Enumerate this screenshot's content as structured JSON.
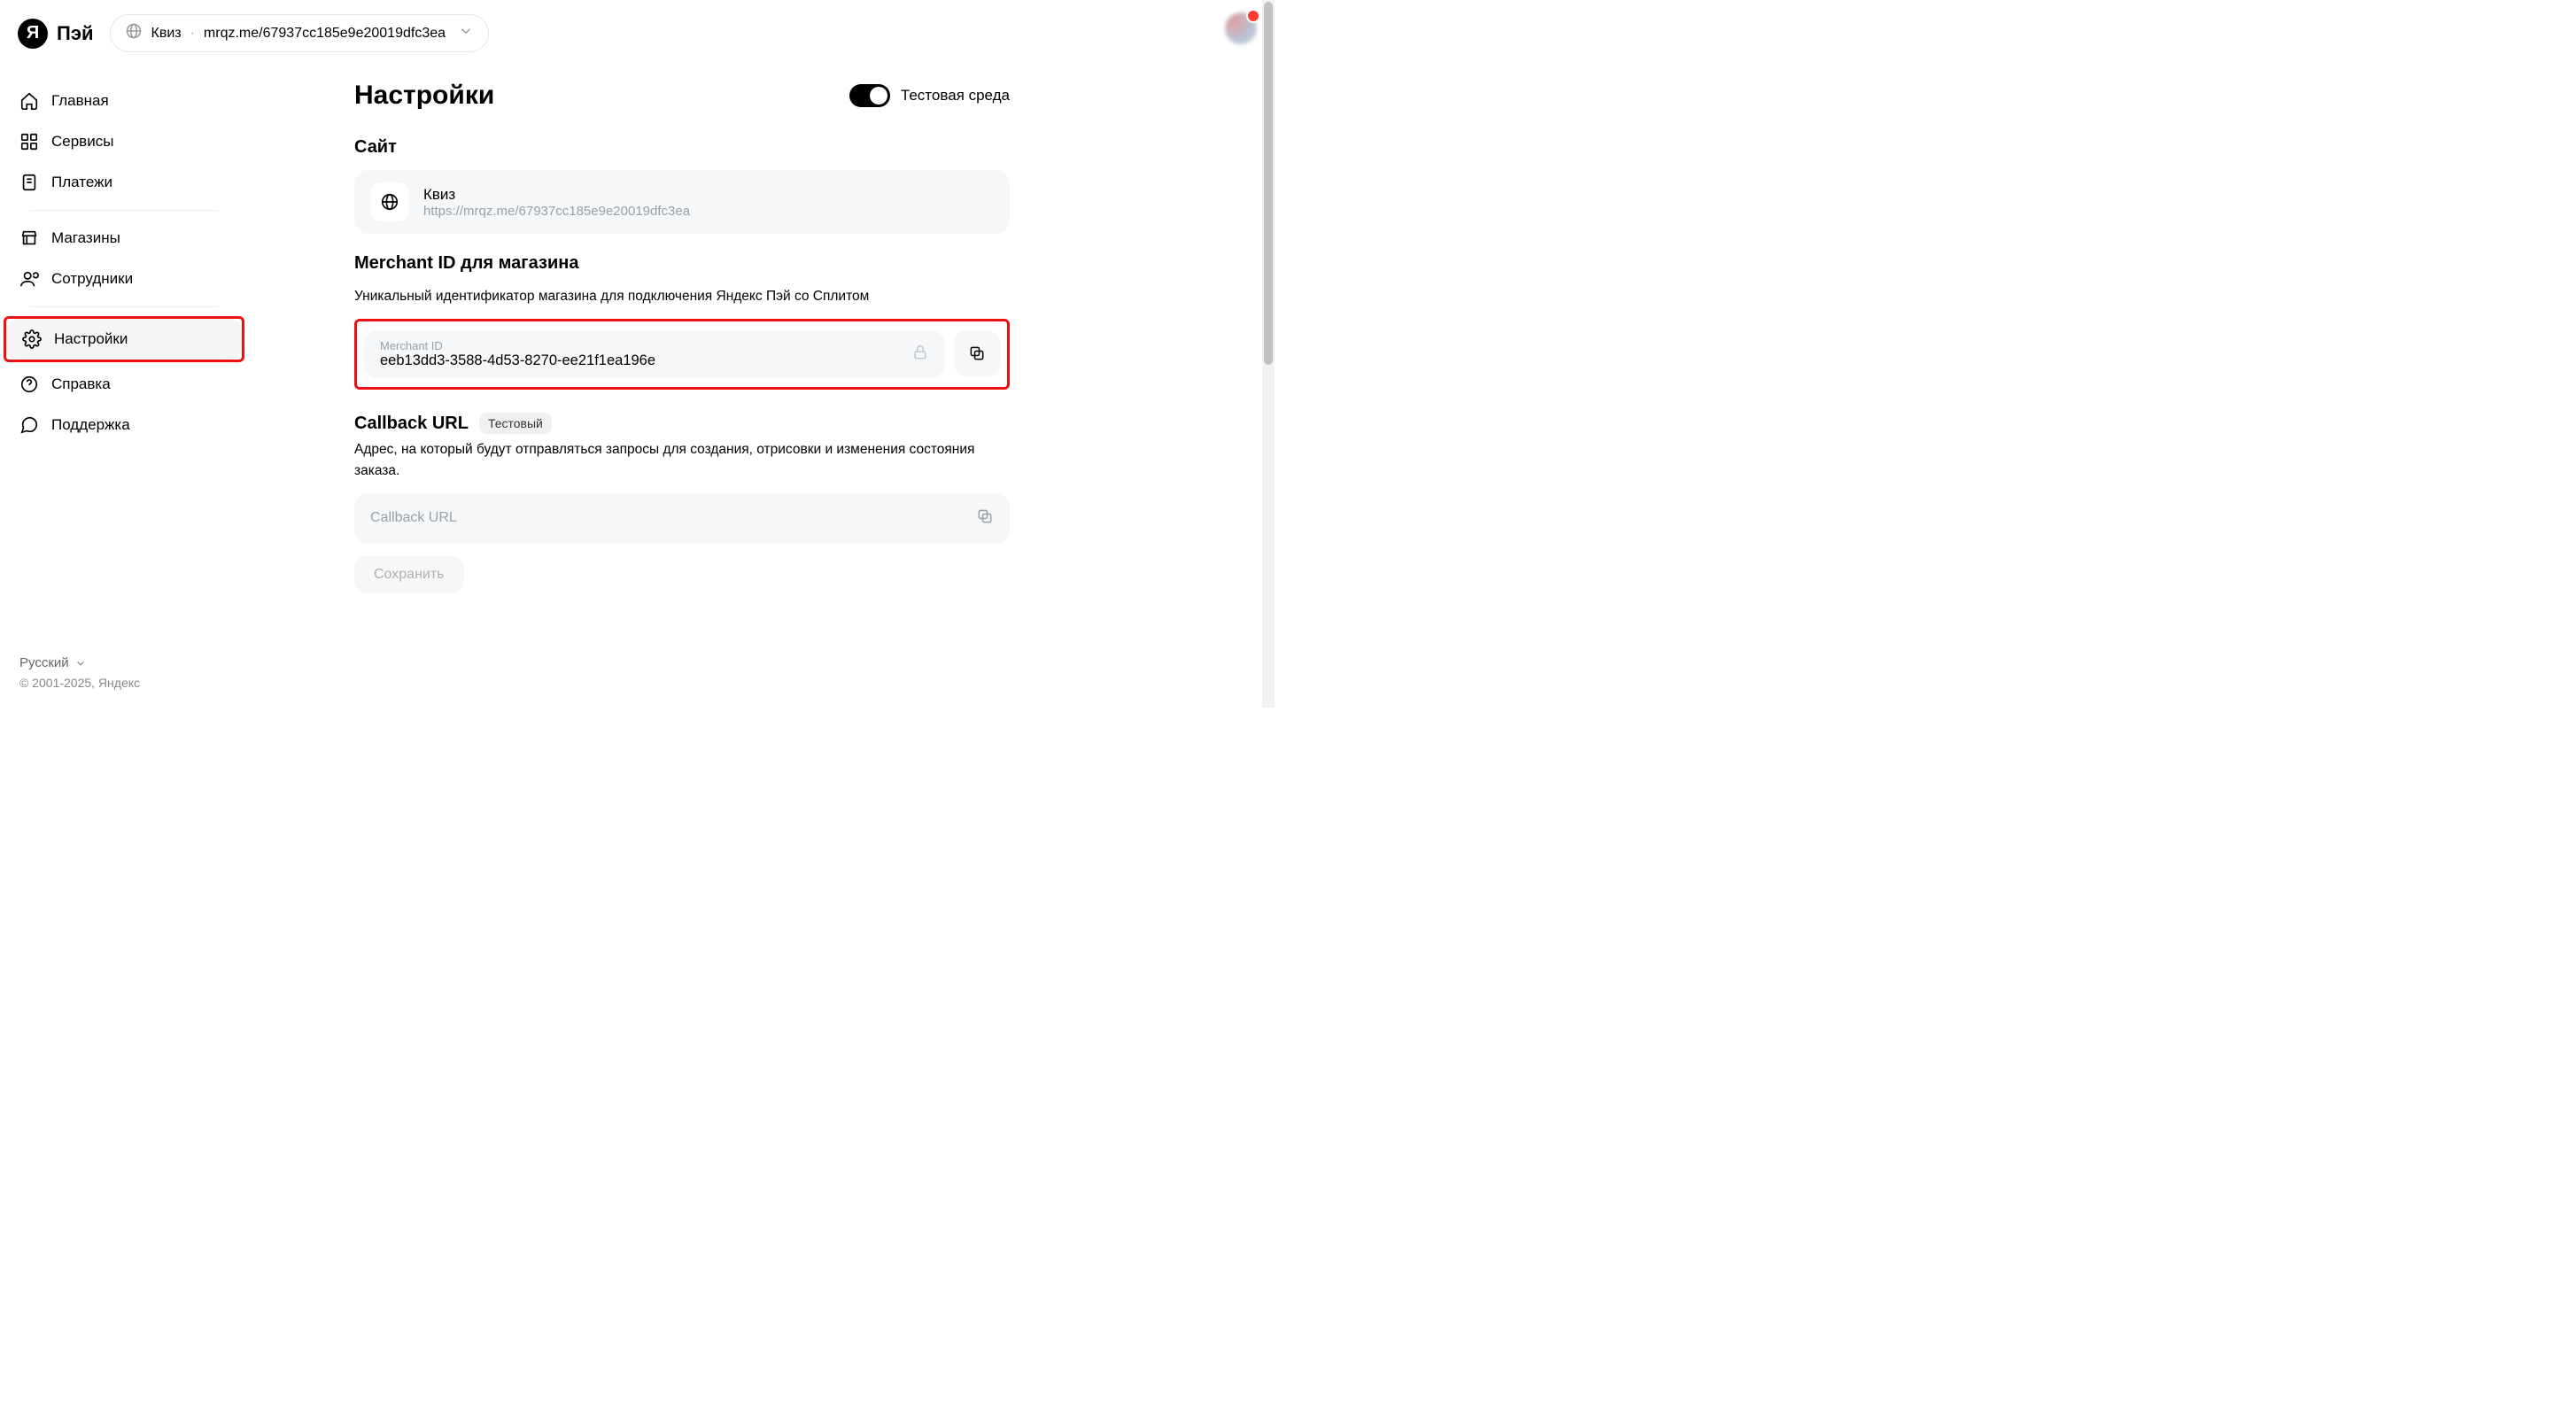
{
  "logo_text": "Пэй",
  "logo_mark": "Я",
  "site_selector": {
    "name": "Квиз",
    "url": "mrqz.me/67937cc185e9e20019dfc3ea"
  },
  "sidebar": {
    "items": [
      {
        "label": "Главная"
      },
      {
        "label": "Сервисы"
      },
      {
        "label": "Платежи"
      },
      {
        "label": "Магазины"
      },
      {
        "label": "Сотрудники"
      },
      {
        "label": "Настройки"
      },
      {
        "label": "Справка"
      },
      {
        "label": "Поддержка"
      }
    ],
    "lang": "Русский",
    "copyright": "© 2001-2025, Яндекс"
  },
  "page": {
    "title": "Настройки",
    "toggle_label": "Тестовая среда",
    "site_section": "Сайт",
    "site_card": {
      "name": "Квиз",
      "url": "https://mrqz.me/67937cc185e9e20019dfc3ea"
    },
    "merchant_title": "Merchant ID для магазина",
    "merchant_desc": "Уникальный идентификатор магазина для подключения Яндекс Пэй со Сплитом",
    "merchant_field_label": "Merchant ID",
    "merchant_value": "eeb13dd3-3588-4d53-8270-ee21f1ea196e",
    "callback_title": "Callback URL",
    "callback_badge": "Тестовый",
    "callback_desc": "Адрес, на который будут отправляться запросы для создания, отрисовки и изменения состояния заказа.",
    "callback_placeholder": "Callback URL",
    "save_label": "Сохранить"
  }
}
